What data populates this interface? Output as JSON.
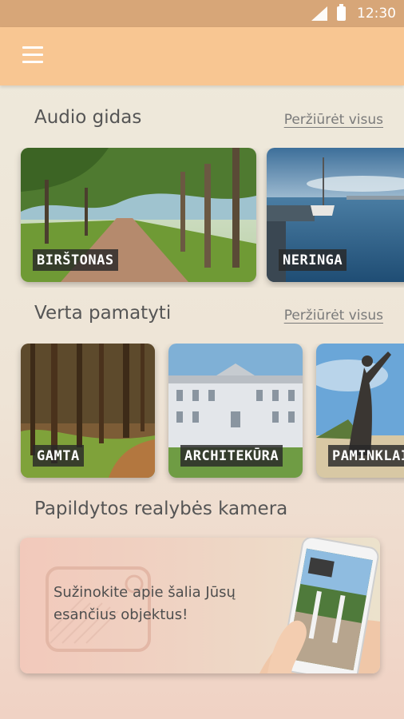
{
  "status_bar": {
    "time": "12:30"
  },
  "sections": {
    "audio_guide": {
      "title": "Audio gidas",
      "see_all": "Peržiūrėt visus",
      "cards": [
        {
          "label": "BIRŠTONAS"
        },
        {
          "label": "NERINGA"
        }
      ]
    },
    "worth_seeing": {
      "title": "Verta pamatyti",
      "see_all": "Peržiūrėt visus",
      "cards": [
        {
          "label": "GAMTA"
        },
        {
          "label": "ARCHITEKŪRA"
        },
        {
          "label": "PAMINKLAI"
        }
      ]
    },
    "ar_camera": {
      "title": "Papildytos realybės kamera",
      "banner_text": "Sužinokite apie šalia Jūsų esančius objektus!"
    }
  },
  "colors": {
    "status_bar": "#d7a678",
    "app_bar": "#f8c692",
    "background": "#eeeadc"
  }
}
